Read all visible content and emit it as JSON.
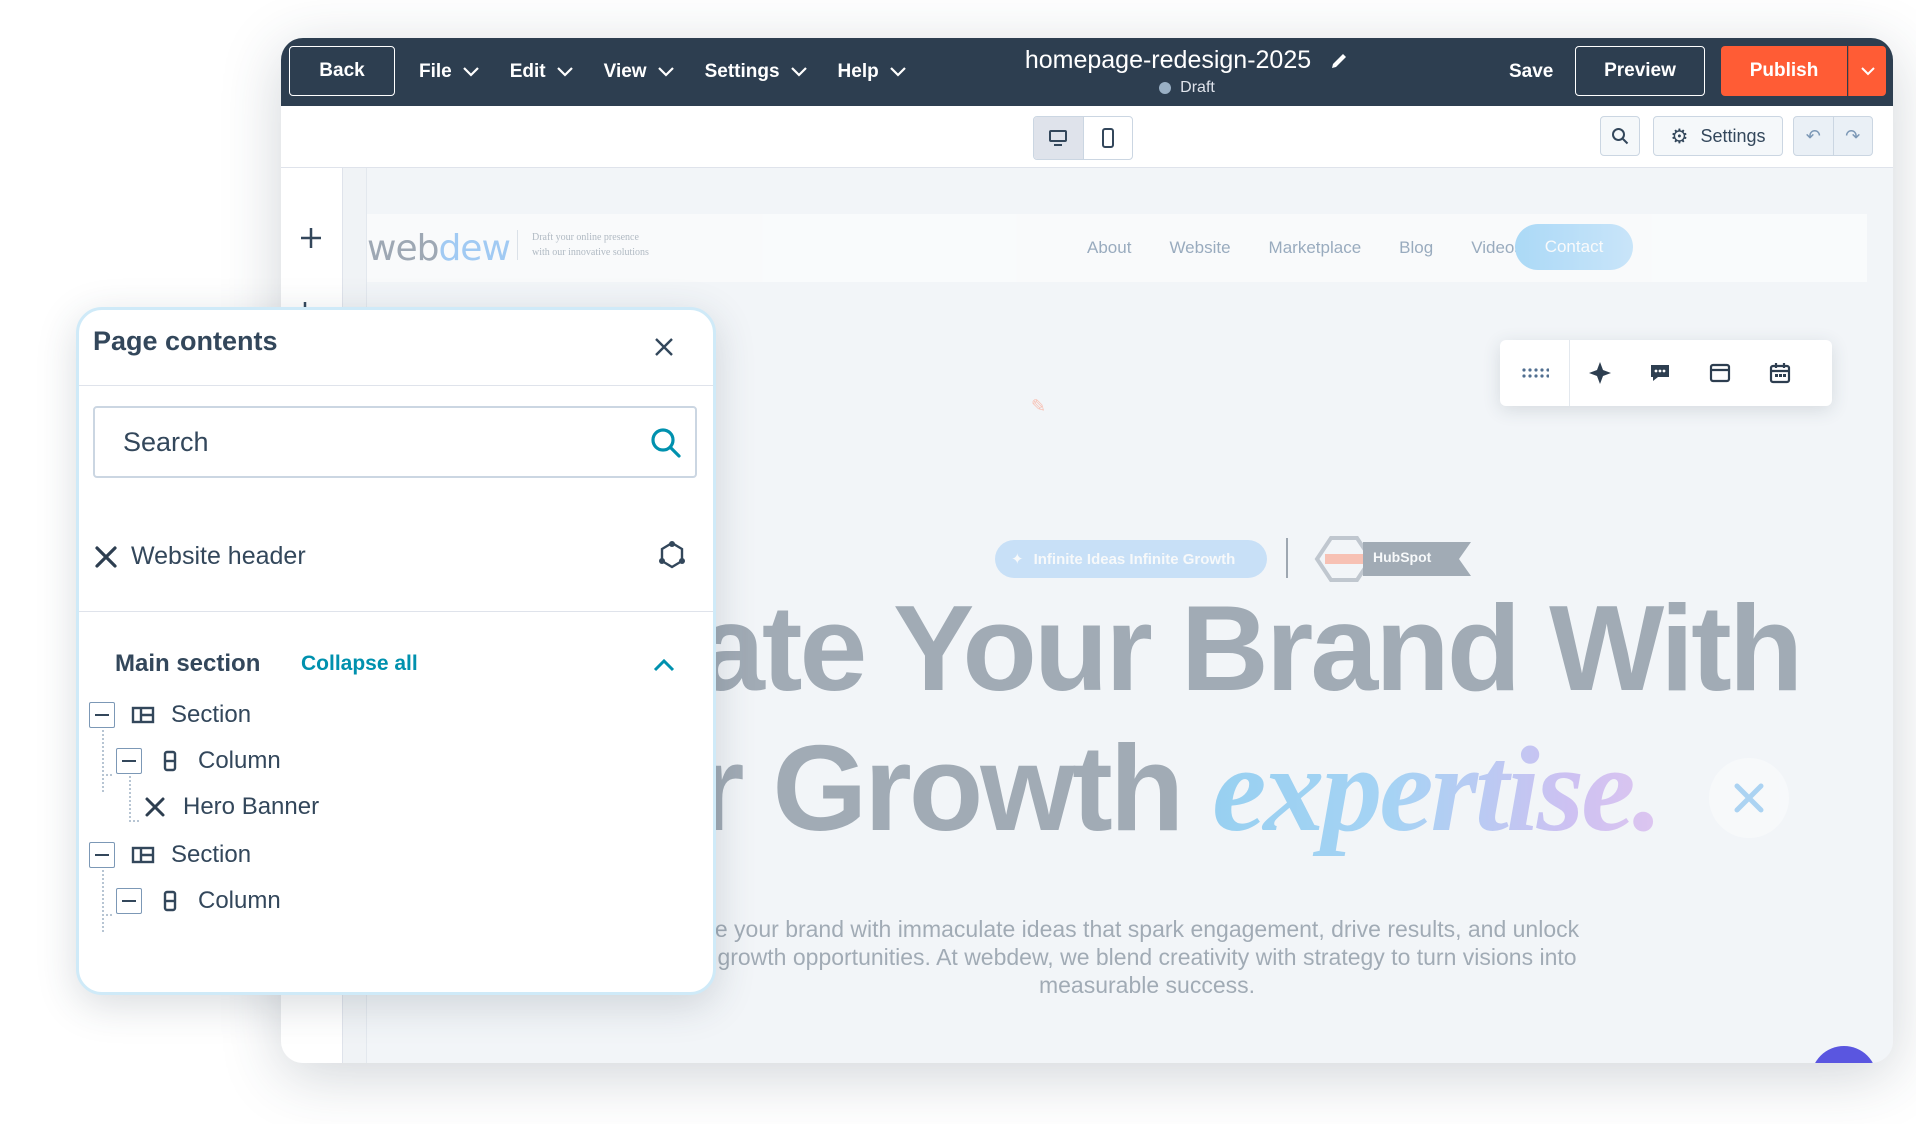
{
  "topbar": {
    "back": "Back",
    "menus": [
      "File",
      "Edit",
      "View",
      "Settings",
      "Help"
    ],
    "doc_name": "homepage-redesign-2025",
    "doc_status": "Draft",
    "save": "Save",
    "preview": "Preview",
    "publish": "Publish"
  },
  "toolbar": {
    "settings": "Settings"
  },
  "site": {
    "logo_a": "web",
    "logo_b": "dew",
    "tagline_1": "Draft your online presence",
    "tagline_2": "with our innovative solutions",
    "nav": [
      "About",
      "Website",
      "Marketplace",
      "Blog",
      "Videos"
    ],
    "contact": "Contact",
    "badge": "Infinite Ideas Infinite Growth",
    "partner": "HubSpot",
    "hero_line1": "ate Your Brand With",
    "hero_line2_a": "r Growth ",
    "hero_line2_b": "expertise.",
    "hero_para": "e your brand with immaculate ideas that spark engagement, drive results, and unlock growth opportunities. At webdew, we blend creativity with strategy to turn visions into measurable success."
  },
  "panel": {
    "title": "Page contents",
    "search_placeholder": "Search",
    "website_header": "Website header",
    "main_section": "Main section",
    "collapse_all": "Collapse all",
    "tree": [
      {
        "label": "Section",
        "kind": "section"
      },
      {
        "label": "Column",
        "kind": "column"
      },
      {
        "label": "Hero Banner",
        "kind": "module"
      },
      {
        "label": "Section",
        "kind": "section"
      },
      {
        "label": "Column",
        "kind": "column"
      }
    ]
  },
  "colors": {
    "topbar": "#2d3e50",
    "publish": "#ff5c35",
    "accent_link": "#0091ae",
    "panel_border": "#cfeaf8"
  },
  "icons": [
    "pencil-icon",
    "chevron-down-icon",
    "desktop-icon",
    "mobile-icon",
    "search-icon",
    "gear-icon",
    "undo-icon",
    "redo-icon",
    "plus-icon",
    "tree-icon",
    "close-icon",
    "tools-icon",
    "globe-icon",
    "chevron-up-icon"
  ]
}
